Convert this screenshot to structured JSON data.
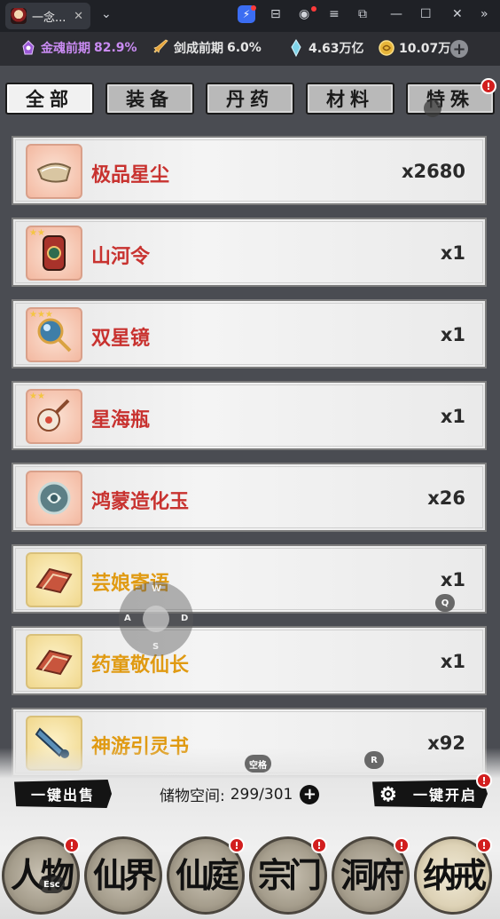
{
  "window": {
    "tab_title": "一念...",
    "tab_close": "✕",
    "new_tab": "⌄",
    "controls": {
      "minimize": "—",
      "maximize": "☐",
      "close": "✕",
      "more": "»"
    }
  },
  "resources": [
    {
      "name": "金魂前期",
      "value": "82.9%",
      "icon": "soul-icon",
      "color": "#c98bf2"
    },
    {
      "name": "剑成前期",
      "value": "6.0%",
      "icon": "sword-icon",
      "color": "#e6e6e6"
    },
    {
      "name": "",
      "value": "4.63万亿",
      "icon": "spirit-crystal-icon",
      "color": "#e6e6e6"
    },
    {
      "name": "",
      "value": "10.07万",
      "icon": "gold-coin-icon",
      "color": "#e6e6e6"
    }
  ],
  "add_resource": "+",
  "categories": [
    {
      "label": "全部",
      "active": true
    },
    {
      "label": "装备",
      "active": false
    },
    {
      "label": "丹药",
      "active": false
    },
    {
      "label": "材料",
      "active": false
    },
    {
      "label": "特殊",
      "active": false,
      "badge": "!"
    }
  ],
  "items": [
    {
      "name": "极品星尘",
      "qty": "x2680",
      "rarity": "red",
      "icon": "stardust-icon"
    },
    {
      "name": "山河令",
      "qty": "x1",
      "rarity": "red",
      "icon": "token-icon",
      "stars": "★★"
    },
    {
      "name": "双星镜",
      "qty": "x1",
      "rarity": "red",
      "icon": "mirror-icon",
      "stars": "★★★"
    },
    {
      "name": "星海瓶",
      "qty": "x1",
      "rarity": "red",
      "icon": "bottle-icon",
      "stars": "★★"
    },
    {
      "name": "鸿蒙造化玉",
      "qty": "x26",
      "rarity": "red",
      "icon": "jade-icon"
    },
    {
      "name": "芸娘寄语",
      "qty": "x1",
      "rarity": "gold",
      "icon": "letter-icon"
    },
    {
      "name": "药童敬仙长",
      "qty": "x1",
      "rarity": "gold",
      "icon": "letter-icon"
    },
    {
      "name": "神游引灵书",
      "qty": "x92",
      "rarity": "gold",
      "icon": "scroll-icon"
    }
  ],
  "bottom": {
    "sell_all": "一键出售",
    "storage_label": "储物空间:",
    "storage_value": "299/301",
    "open_all": "一键开启"
  },
  "nav": [
    {
      "label": "人物",
      "badge": "!"
    },
    {
      "label": "仙界",
      "badge": ""
    },
    {
      "label": "仙庭",
      "badge": "!"
    },
    {
      "label": "宗门",
      "badge": "!"
    },
    {
      "label": "洞府",
      "badge": "!"
    },
    {
      "label": "纳戒",
      "badge": "!",
      "active": true
    }
  ],
  "keymap": {
    "up": "W",
    "left": "A",
    "right": "D",
    "down": "S",
    "q": "Q",
    "r": "R",
    "space": "空格",
    "esc": "Esc"
  }
}
